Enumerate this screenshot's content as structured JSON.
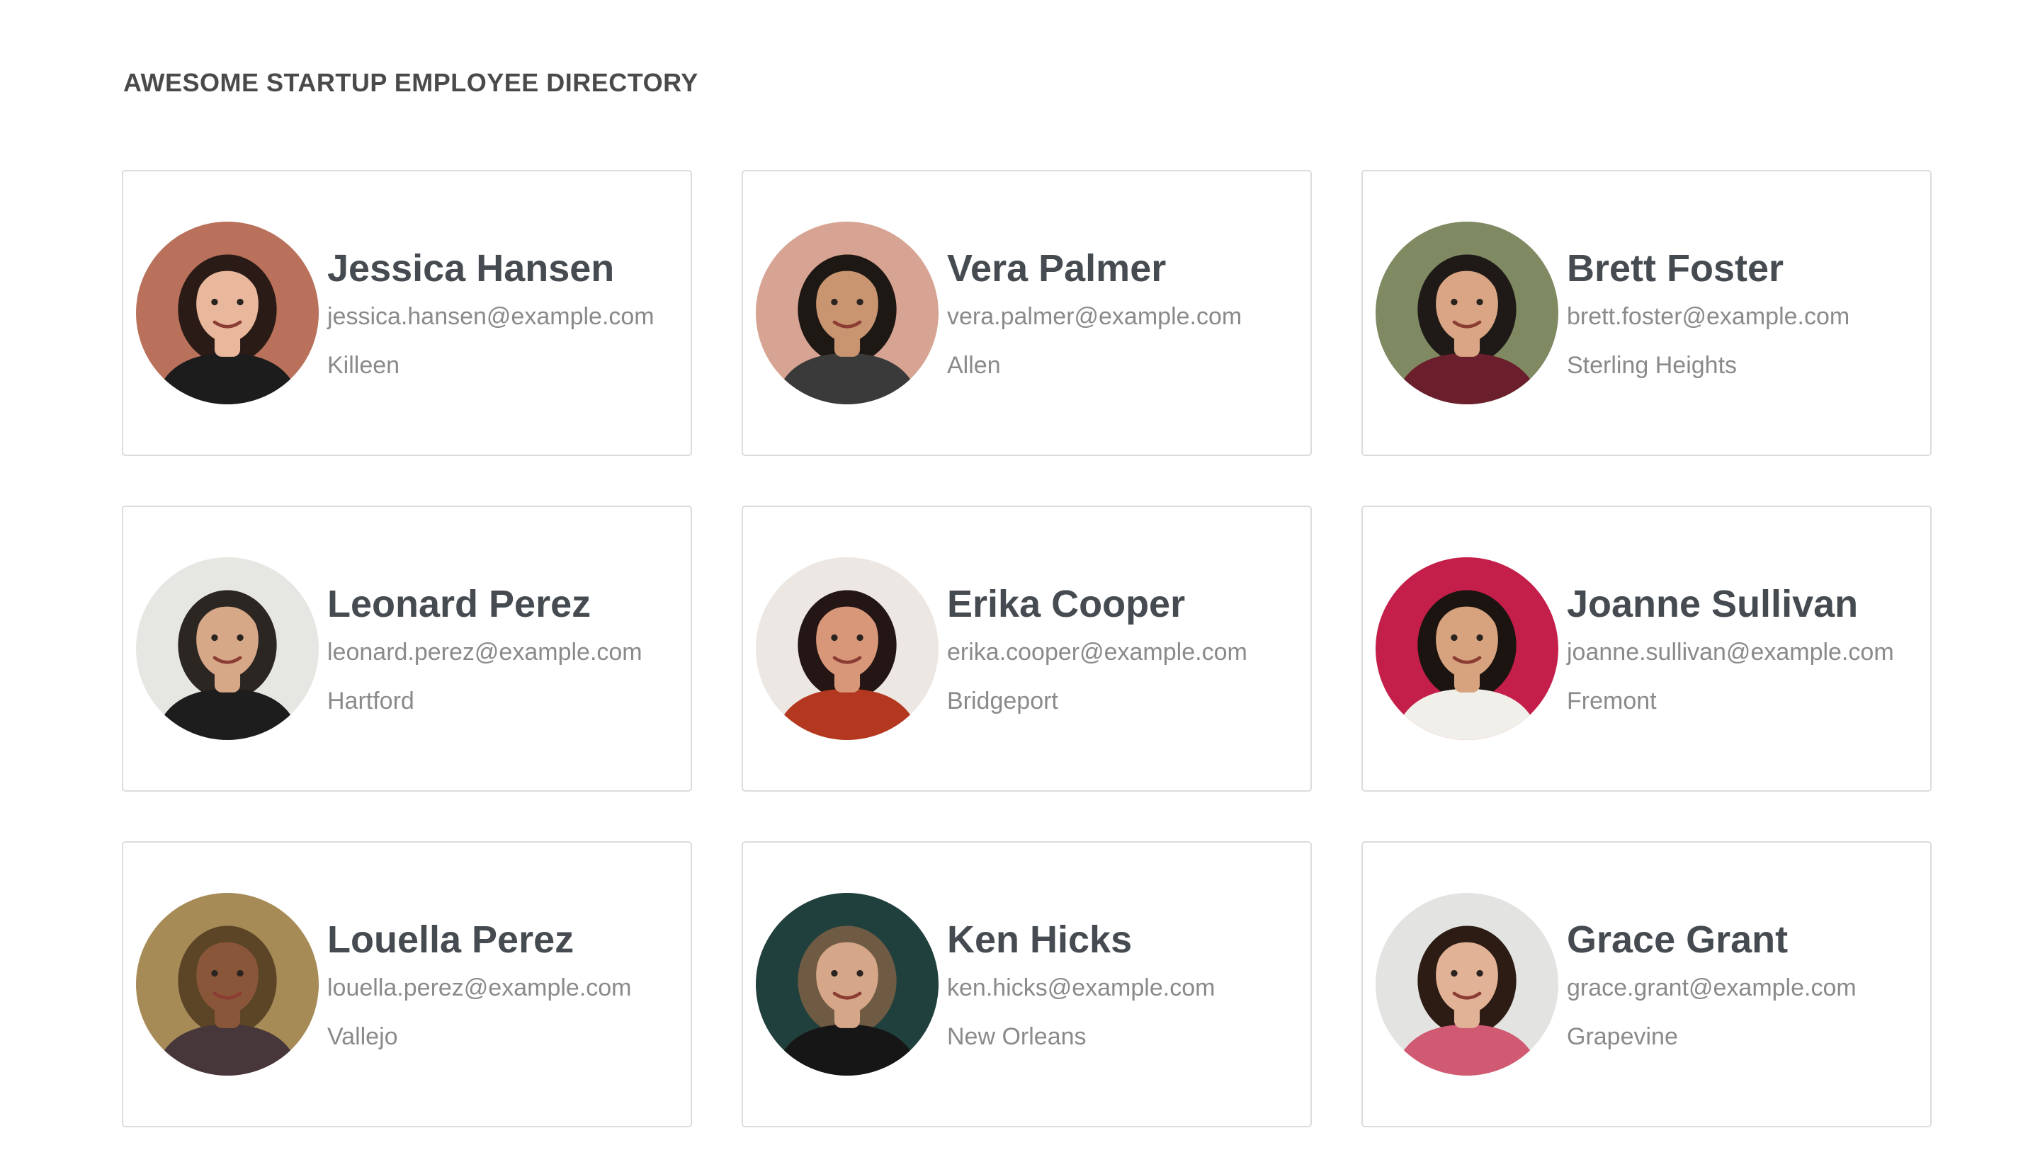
{
  "header": {
    "title": "AWESOME STARTUP EMPLOYEE DIRECTORY"
  },
  "employees": [
    {
      "name": "Jessica Hansen",
      "email": "jessica.hansen@example.com",
      "city": "Killeen",
      "avatar": {
        "bg": "#b9715c",
        "skin": "#e9b79c",
        "hair": "#2a1b16",
        "shirt": "#1c1c1c"
      }
    },
    {
      "name": "Vera Palmer",
      "email": "vera.palmer@example.com",
      "city": "Allen",
      "avatar": {
        "bg": "#d7a493",
        "skin": "#c99470",
        "hair": "#1e1814",
        "shirt": "#3a3a3a"
      }
    },
    {
      "name": "Brett Foster",
      "email": "brett.foster@example.com",
      "city": "Sterling Heights",
      "avatar": {
        "bg": "#7f8a62",
        "skin": "#d9a584",
        "hair": "#1f1a17",
        "shirt": "#6b1e2c"
      }
    },
    {
      "name": "Leonard Perez",
      "email": "leonard.perez@example.com",
      "city": "Hartford",
      "avatar": {
        "bg": "#e6e6e2",
        "skin": "#d6a887",
        "hair": "#2b2622",
        "shirt": "#1d1d1d"
      }
    },
    {
      "name": "Erika Cooper",
      "email": "erika.cooper@example.com",
      "city": "Bridgeport",
      "avatar": {
        "bg": "#ece7e2",
        "skin": "#d9977a",
        "hair": "#231614",
        "shirt": "#b4371f"
      }
    },
    {
      "name": "Joanne Sullivan",
      "email": "joanne.sullivan@example.com",
      "city": "Fremont",
      "avatar": {
        "bg": "#c41f4a",
        "skin": "#d7a27e",
        "hair": "#1c1410",
        "shirt": "#f1efe9"
      }
    },
    {
      "name": "Louella Perez",
      "email": "louella.perez@example.com",
      "city": "Vallejo",
      "avatar": {
        "bg": "#a78b57",
        "skin": "#8a563a",
        "hair": "#5b4526",
        "shirt": "#47363a"
      }
    },
    {
      "name": "Ken Hicks",
      "email": "ken.hicks@example.com",
      "city": "New Orleans",
      "avatar": {
        "bg": "#20403d",
        "skin": "#d6a688",
        "hair": "#6f5a43",
        "shirt": "#161616"
      }
    },
    {
      "name": "Grace Grant",
      "email": "grace.grant@example.com",
      "city": "Grapevine",
      "avatar": {
        "bg": "#e3e3e1",
        "skin": "#e1b295",
        "hair": "#2c1c14",
        "shirt": "#d05a72"
      }
    }
  ]
}
